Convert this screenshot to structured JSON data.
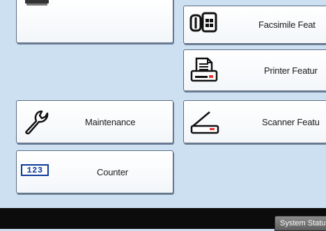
{
  "left_tiles": [
    {
      "label": ""
    },
    {
      "label": "Maintenance"
    },
    {
      "label": "Counter"
    }
  ],
  "right_tiles": [
    {
      "label": "Facsimile Feat"
    },
    {
      "label": "Printer Featur"
    },
    {
      "label": "Scanner Featu"
    }
  ],
  "counter_icon_text": "123",
  "status_button": {
    "label": "System Statu"
  },
  "colors": {
    "background": "#cde0f2",
    "tile_border": "#5b6c80",
    "bottom_bar": "#0c0c0c",
    "counter_icon": "#0a3a9c"
  }
}
